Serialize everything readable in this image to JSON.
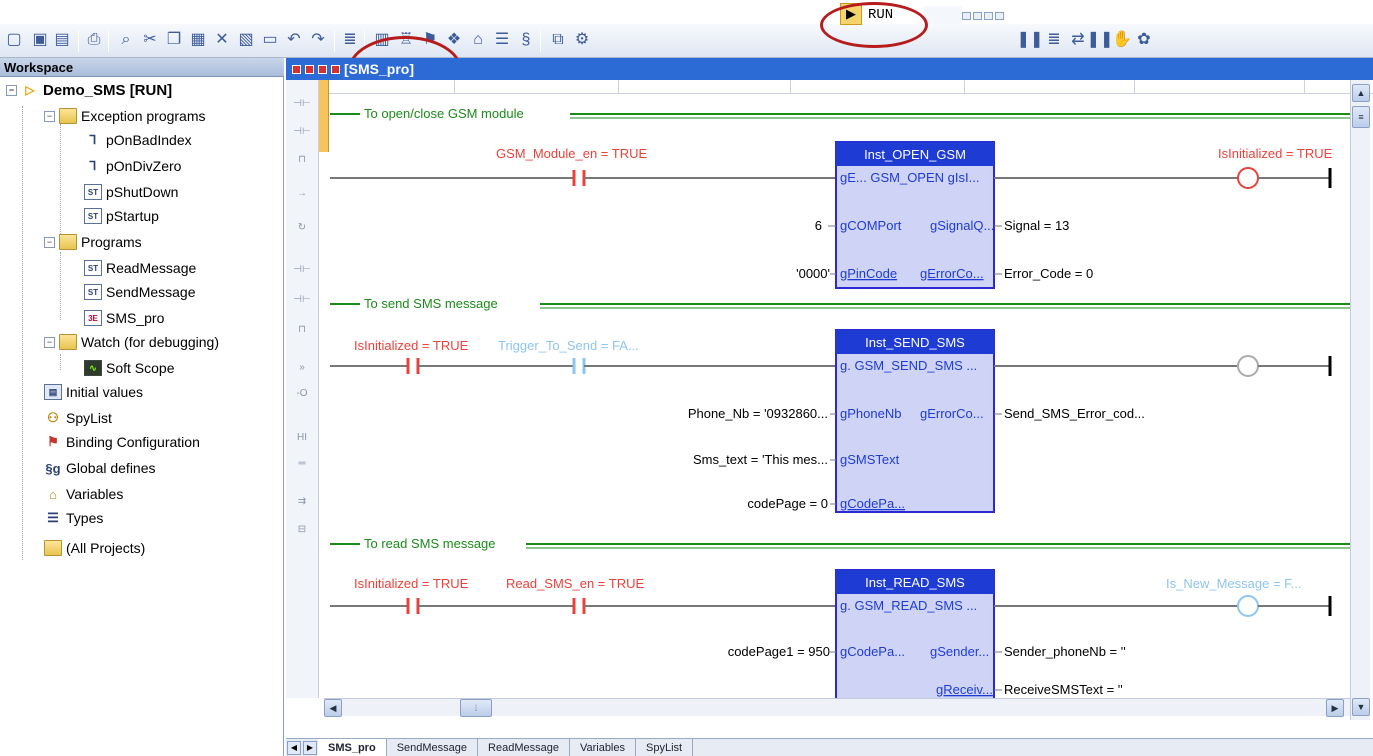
{
  "workspace": {
    "title": "Workspace",
    "project": "Demo_SMS [RUN]",
    "tree": [
      {
        "label": "Exception programs"
      },
      {
        "label": "pOnBadIndex"
      },
      {
        "label": "pOnDivZero"
      },
      {
        "label": "pShutDown"
      },
      {
        "label": "pStartup"
      },
      {
        "label": "Programs"
      },
      {
        "label": "ReadMessage"
      },
      {
        "label": "SendMessage"
      },
      {
        "label": "SMS_pro"
      },
      {
        "label": "Watch (for debugging)"
      },
      {
        "label": "Soft Scope"
      },
      {
        "label": "Initial values"
      },
      {
        "label": "SpyList"
      },
      {
        "label": "Binding Configuration"
      },
      {
        "label": "Global defines"
      },
      {
        "label": "Variables"
      },
      {
        "label": "Types"
      },
      {
        "label": "(All Projects)"
      }
    ],
    "icon_glyphs": {
      "st": "ST",
      "ld": "3E",
      "sg": "§g"
    }
  },
  "toolbar": {
    "run_label": "RUN"
  },
  "editor": {
    "title": "[SMS_pro]",
    "tabs": [
      "SMS_pro",
      "SendMessage",
      "ReadMessage",
      "Variables",
      "SpyList"
    ],
    "rungs": {
      "open_title": "To open/close GSM module",
      "send_title": "To send SMS message",
      "read_title": "To read SMS message"
    },
    "open_gsm": {
      "contact": "GSM_Module_en = TRUE",
      "block_name": "Inst_OPEN_GSM",
      "row1": "gE...  GSM_OPEN gIsI...",
      "in_port": "gCOMPort",
      "in_port_val": "6",
      "in_pin": "gPinCode",
      "in_pin_val": "'0000'",
      "out_signal": "gSignalQ...",
      "out_signal_val": "Signal = 13",
      "out_error": "gErrorCo...",
      "out_error_val": "Error_Code = 0",
      "coil": "IsInitialized = TRUE"
    },
    "send_sms": {
      "contact1": "IsInitialized = TRUE",
      "contact2": "Trigger_To_Send = FA...",
      "block_name": "Inst_SEND_SMS",
      "row1": "g.  GSM_SEND_SMS ...",
      "in_phone": "gPhoneNb",
      "in_phone_val": "Phone_Nb = '0932860...",
      "in_text": "gSMSText",
      "in_text_val": "Sms_text = 'This mes...",
      "in_code": "gCodePa...",
      "in_code_val": "codePage = 0",
      "out_error": "gErrorCo...",
      "out_error_val": "Send_SMS_Error_cod..."
    },
    "read_sms": {
      "contact1": "IsInitialized = TRUE",
      "contact2": "Read_SMS_en = TRUE",
      "block_name": "Inst_READ_SMS",
      "row1": "g. GSM_READ_SMS ...",
      "in_code": "gCodePa...",
      "in_code_val": "codePage1 = 950",
      "out_sender": "gSender...",
      "out_sender_val": "Sender_phoneNb = ''",
      "out_receive": "gReceiv...",
      "out_receive_val": "ReceiveSMSText = ''",
      "coil": "Is_New_Message = F..."
    }
  },
  "colors": {
    "true_red": "#e8423a",
    "false_blue": "#8ec5ef",
    "rung_green": "#1a8c1a",
    "block_fill": "#cfd4f7",
    "block_border": "#2a2ad0",
    "block_header": "#1e3bd4"
  }
}
